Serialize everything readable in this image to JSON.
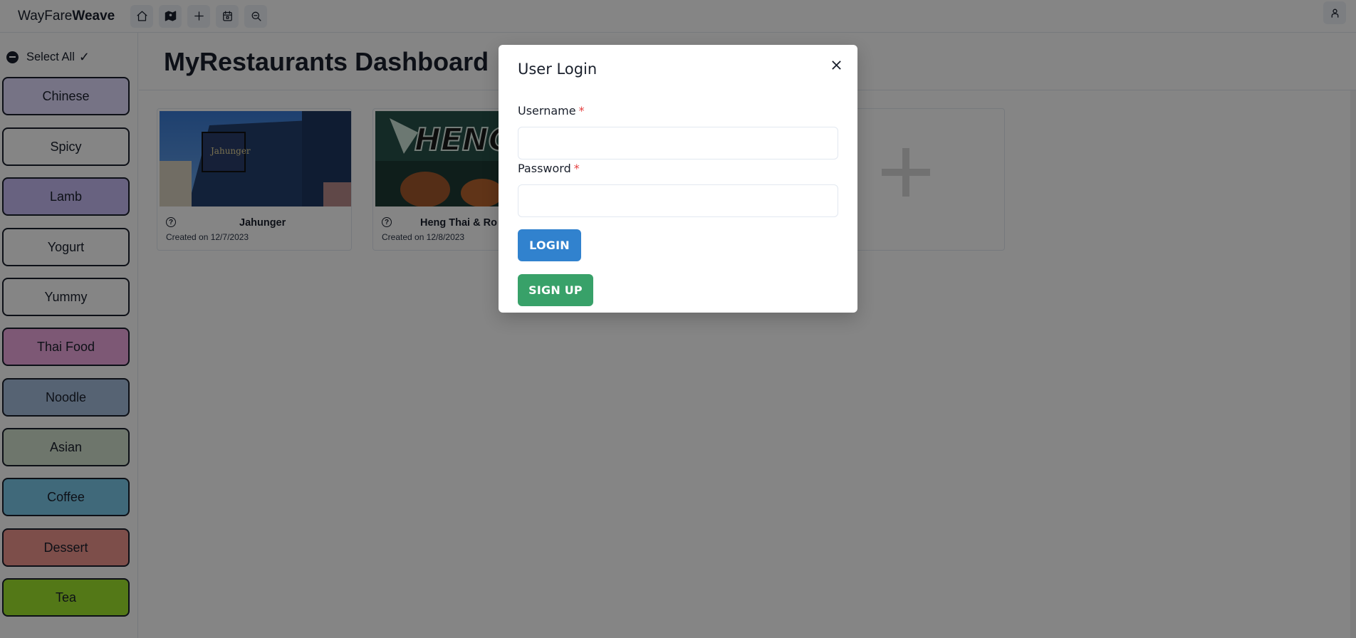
{
  "brand": {
    "prefix": "WayFare",
    "suffix": "Weave"
  },
  "nav_icons": [
    "home-icon",
    "map-icon",
    "plus-icon",
    "calendar-icon",
    "search-icon"
  ],
  "user_icon": "user-icon",
  "sidebar": {
    "select_all_label": "Select All",
    "select_all_check": "✓",
    "categories": [
      {
        "label": "Chinese",
        "color": "#e3dcff"
      },
      {
        "label": "Spicy",
        "color": "#ffffff"
      },
      {
        "label": "Lamb",
        "color": "#c8bcf5"
      },
      {
        "label": "Yogurt",
        "color": "#ffffff"
      },
      {
        "label": "Yummy",
        "color": "#ffffff"
      },
      {
        "label": "Thai Food",
        "color": "#f0a9e0"
      },
      {
        "label": "Noodle",
        "color": "#a5bedc"
      },
      {
        "label": "Asian",
        "color": "#d4e2cf"
      },
      {
        "label": "Coffee",
        "color": "#7cc9ea"
      },
      {
        "label": "Dessert",
        "color": "#f0968e"
      },
      {
        "label": "Tea",
        "color": "#9fe62c"
      }
    ]
  },
  "main": {
    "title": "MyRestaurants Dashboard",
    "cards": [
      {
        "name": "Jahunger",
        "date": "Created on 12/7/2023"
      },
      {
        "name": "Heng Thai & Ro",
        "date": "Created on 12/8/2023"
      }
    ]
  },
  "modal": {
    "title": "User Login",
    "username_label": "Username",
    "password_label": "Password",
    "required_mark": "*",
    "login_label": "LOGIN",
    "signup_label": "SIGN UP",
    "username_value": "",
    "password_value": ""
  },
  "colors": {
    "login_button": "#3182ce",
    "signup_button": "#38a169",
    "required": "#e53e3e"
  }
}
